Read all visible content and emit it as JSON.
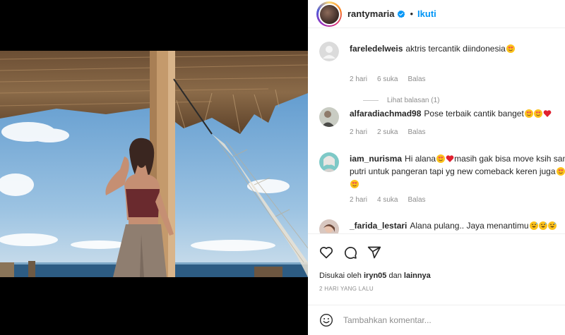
{
  "header": {
    "username": "rantymaria",
    "separator": "•",
    "follow_label": "Ikuti"
  },
  "comments": [
    {
      "username": "fareledelweis",
      "text": "aktris tercantik diindonesia",
      "emojis": [
        "heart-eyes"
      ],
      "time": "2 hari",
      "likes": "6 suka",
      "reply": "Balas",
      "replies_label": "Lihat balasan (1)"
    },
    {
      "username": "alfaradiachmad98",
      "text": "Pose terbaik cantik banget",
      "emojis": [
        "heart-eyes",
        "heart-eyes",
        "red-heart"
      ],
      "time": "2 hari",
      "likes": "2 suka",
      "reply": "Balas"
    },
    {
      "username": "iam_nurisma",
      "text_part1": "Hi alana",
      "text_part2": "masih gak bisa move ksih sama putri untuk pangeran tapi yg new comeback keren juga",
      "emojis": [
        "heart-eyes",
        "red-heart",
        "heart-eyes",
        "heart-eyes",
        "heart-eyes"
      ],
      "time": "2 hari",
      "likes": "4 suka",
      "reply": "Balas"
    },
    {
      "username": "_farida_lestari",
      "text": "Alana pulang.. Jaya menantimu",
      "emojis": [
        "grinning-sweat",
        "grinning-sweat",
        "grinning-sweat"
      ]
    }
  ],
  "actions": {
    "icons": [
      "heart-icon",
      "comment-icon",
      "share-icon"
    ],
    "liked_prefix": "Disukai oleh",
    "liked_user": "iryn05",
    "liked_conj": "dan",
    "liked_others": "lainnya",
    "time_ago": "2 HARI YANG LALU"
  },
  "add_comment": {
    "placeholder": "Tambahkan komentar..."
  },
  "colors": {
    "accent": "#0095f6",
    "muted": "#8e8e8e",
    "heart": "#ed4956",
    "emoji_face": "#fcc21b"
  }
}
